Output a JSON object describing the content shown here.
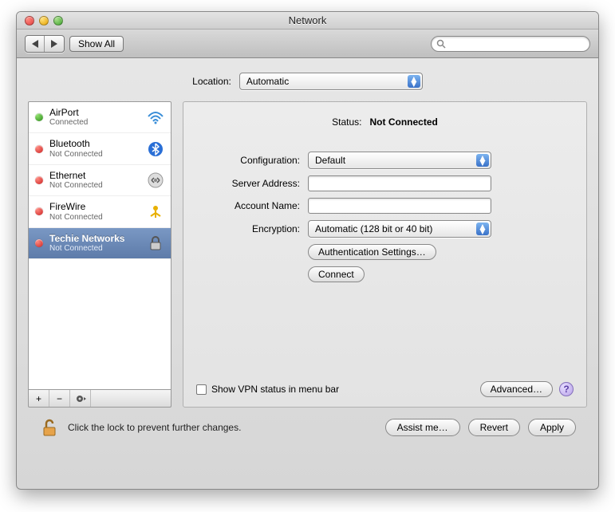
{
  "window": {
    "title": "Network"
  },
  "toolbar": {
    "show_all": "Show All",
    "search_placeholder": ""
  },
  "location": {
    "label": "Location:",
    "value": "Automatic"
  },
  "sidebar": {
    "items": [
      {
        "name": "AirPort",
        "sub": "Connected",
        "status": "green",
        "icon": "wifi"
      },
      {
        "name": "Bluetooth",
        "sub": "Not Connected",
        "status": "red",
        "icon": "bluetooth"
      },
      {
        "name": "Ethernet",
        "sub": "Not Connected",
        "status": "red",
        "icon": "ethernet"
      },
      {
        "name": "FireWire",
        "sub": "Not Connected",
        "status": "red",
        "icon": "firewire"
      },
      {
        "name": "Techie Networks",
        "sub": "Not Connected",
        "status": "red",
        "icon": "vpn",
        "selected": true
      }
    ]
  },
  "panel": {
    "status_label": "Status:",
    "status_value": "Not Connected",
    "config_label": "Configuration:",
    "config_value": "Default",
    "server_label": "Server Address:",
    "server_value": "",
    "account_label": "Account Name:",
    "account_value": "",
    "encryption_label": "Encryption:",
    "encryption_value": "Automatic (128 bit or 40 bit)",
    "auth_btn": "Authentication Settings…",
    "connect_btn": "Connect",
    "show_vpn": "Show VPN status in menu bar",
    "advanced_btn": "Advanced…"
  },
  "footer": {
    "lock_hint": "Click the lock to prevent further changes.",
    "assist": "Assist me…",
    "revert": "Revert",
    "apply": "Apply"
  }
}
